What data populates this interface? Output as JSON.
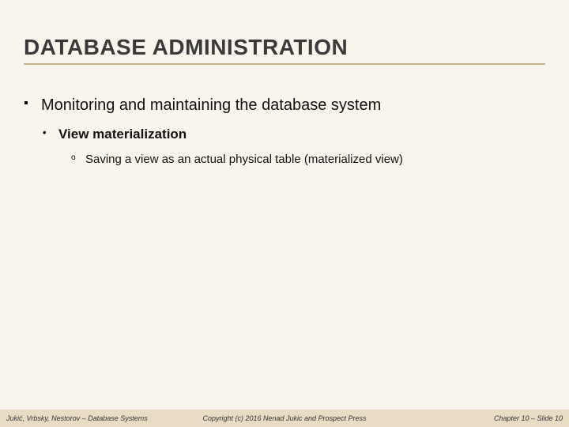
{
  "title": "DATABASE ADMINISTRATION",
  "bullets": {
    "lvl1": "Monitoring and maintaining the database system",
    "lvl2": "View materialization",
    "lvl3": "Saving a view as an actual physical table (materialized view)"
  },
  "footer": {
    "left": "Jukić, Vrbsky, Nestorov – Database Systems",
    "center": "Copyright (c) 2016 Nenad Jukic and Prospect Press",
    "right": "Chapter 10 – Slide 10"
  }
}
